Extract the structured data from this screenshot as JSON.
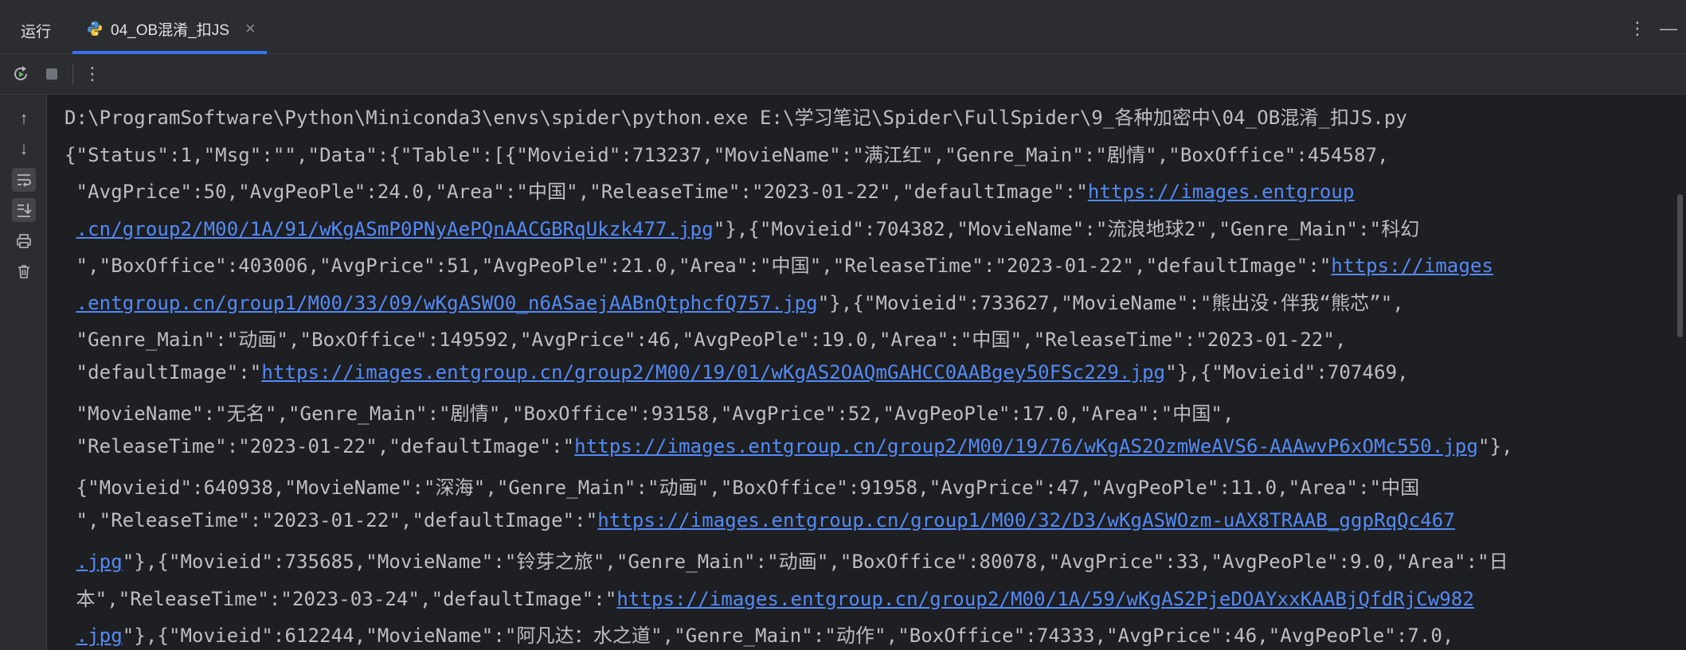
{
  "tabbar": {
    "run_label": "运行",
    "tab_title": "04_OB混淆_扣JS",
    "close_glyph": "×",
    "more_glyph": "⋮",
    "minimize_glyph": "—"
  },
  "toolbar": {
    "rerun_icon": "rerun-icon",
    "stop_icon": "stop-icon",
    "more_glyph": "⋮"
  },
  "leftbar": {
    "icons": [
      "up-arrow-icon",
      "down-arrow-icon",
      "soft-wrap-icon",
      "scroll-to-end-icon",
      "print-icon",
      "trash-icon"
    ],
    "up_glyph": "↑",
    "down_glyph": "↓"
  },
  "console": {
    "lines": [
      {
        "text": "D:\\ProgramSoftware\\Python\\Miniconda3\\envs\\spider\\python.exe E:\\学习笔记\\Spider\\FullSpider\\9_各种加密中\\04_OB混淆_扣JS.py"
      },
      {
        "text": "{\"Status\":1,\"Msg\":\"\",\"Data\":{\"Table\":[{\"Movieid\":713237,\"MovieName\":\"满江红\",\"Genre_Main\":\"剧情\",\"BoxOffice\":454587,"
      },
      {
        "pre": " \"AvgPrice\":50,\"AvgPeoPle\":24.0,\"Area\":\"中国\",\"ReleaseTime\":\"2023-01-22\",\"defaultImage\":\"",
        "link": "https://images.entgroup",
        "post": ""
      },
      {
        "pre": " ",
        "link": ".cn/group2/M00/1A/91/wKgASmP0PNyAePQnAACGBRqUkzk477.jpg",
        "post": "\"},{\"Movieid\":704382,\"MovieName\":\"流浪地球2\",\"Genre_Main\":\"科幻"
      },
      {
        "pre": " \",\"BoxOffice\":403006,\"AvgPrice\":51,\"AvgPeoPle\":21.0,\"Area\":\"中国\",\"ReleaseTime\":\"2023-01-22\",\"defaultImage\":\"",
        "link": "https://images",
        "post": ""
      },
      {
        "pre": " ",
        "link": ".entgroup.cn/group1/M00/33/09/wKgASWO0_n6ASaejAABnQtphcfQ757.jpg",
        "post": "\"},{\"Movieid\":733627,\"MovieName\":\"熊出没·伴我“熊芯”\","
      },
      {
        "text": " \"Genre_Main\":\"动画\",\"BoxOffice\":149592,\"AvgPrice\":46,\"AvgPeoPle\":19.0,\"Area\":\"中国\",\"ReleaseTime\":\"2023-01-22\","
      },
      {
        "pre": " \"defaultImage\":\"",
        "link": "https://images.entgroup.cn/group2/M00/19/01/wKgAS2OAQmGAHCC0AABgey50FSc229.jpg",
        "post": "\"},{\"Movieid\":707469,"
      },
      {
        "text": " \"MovieName\":\"无名\",\"Genre_Main\":\"剧情\",\"BoxOffice\":93158,\"AvgPrice\":52,\"AvgPeoPle\":17.0,\"Area\":\"中国\","
      },
      {
        "pre": " \"ReleaseTime\":\"2023-01-22\",\"defaultImage\":\"",
        "link": "https://images.entgroup.cn/group2/M00/19/76/wKgAS2OzmWeAVS6-AAAwvP6xOMc550.jpg",
        "post": "\"},"
      },
      {
        "text": " {\"Movieid\":640938,\"MovieName\":\"深海\",\"Genre_Main\":\"动画\",\"BoxOffice\":91958,\"AvgPrice\":47,\"AvgPeoPle\":11.0,\"Area\":\"中国"
      },
      {
        "pre": " \",\"ReleaseTime\":\"2023-01-22\",\"defaultImage\":\"",
        "link": "https://images.entgroup.cn/group1/M00/32/D3/wKgASWOzm-uAX8TRAAB_ggpRqQc467",
        "post": ""
      },
      {
        "pre": " ",
        "link": ".jpg",
        "post": "\"},{\"Movieid\":735685,\"MovieName\":\"铃芽之旅\",\"Genre_Main\":\"动画\",\"BoxOffice\":80078,\"AvgPrice\":33,\"AvgPeoPle\":9.0,\"Area\":\"日"
      },
      {
        "pre": " 本\",\"ReleaseTime\":\"2023-03-24\",\"defaultImage\":\"",
        "link": "https://images.entgroup.cn/group2/M00/1A/59/wKgAS2PjeDOAYxxKAABjQfdRjCw982",
        "post": ""
      },
      {
        "pre": " ",
        "link": ".jpg",
        "post": "\"},{\"Movieid\":612244,\"MovieName\":\"阿凡达：水之道\",\"Genre_Main\":\"动作\",\"BoxOffice\":74333,\"AvgPrice\":46,\"AvgPeoPle\":7.0,"
      }
    ]
  },
  "colors": {
    "background": "#1e1f22",
    "panel": "#2b2d30",
    "text": "#bcbec4",
    "link": "#548af7",
    "tab_accent": "#3574f0"
  }
}
